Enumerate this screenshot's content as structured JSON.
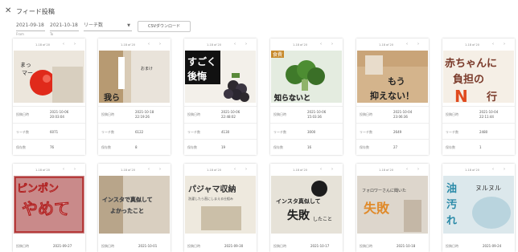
{
  "header": {
    "close_icon": "close-icon",
    "title": "フィード投稿",
    "date_from": "2021-09-18",
    "date_from_sub": "From",
    "date_to": "2021-10-18",
    "date_to_sub": "To",
    "sort_select": "リーチ数",
    "csv_button": "CSVダウンロード"
  },
  "labels": {
    "posted": "投稿日時",
    "reach": "リーチ数",
    "saves": "保存数"
  },
  "cards": [
    {
      "page": "1-18 of 20",
      "date": "2021-10-06",
      "time": "20:03:04",
      "reach": "6071",
      "saves": "76",
      "bg": "#e9e2d6"
    },
    {
      "page": "1-18 of 20",
      "date": "2021-10-18",
      "time": "22:19:26",
      "reach": "6122",
      "saves": "8",
      "bg": "#ddd2c3"
    },
    {
      "page": "1-18 of 20",
      "date": "2021-10-06",
      "time": "22:48:02",
      "reach": "4130",
      "saves": "19",
      "bg": "#f0ede8"
    },
    {
      "page": "1-18 of 20",
      "date": "2021-10-06",
      "time": "15:03:36",
      "reach": "3000",
      "saves": "16",
      "bg": "#d8e6d2"
    },
    {
      "page": "1-18 of 20",
      "date": "2021-10-04",
      "time": "23:06:36",
      "reach": "2649",
      "saves": "27",
      "bg": "#e6cfb0"
    },
    {
      "page": "1-18 of 20",
      "date": "2021-10-04",
      "time": "22:11:44",
      "reach": "2480",
      "saves": "1",
      "bg": "#f4ebe0"
    },
    {
      "page": "1-18 of 20",
      "date": "2021-09-27",
      "bg": "#c98a8a"
    },
    {
      "page": "1-18 of 20",
      "date": "2021-10-01",
      "bg": "#d9cfc0"
    },
    {
      "page": "1-18 of 20",
      "date": "2021-09-30",
      "bg": "#e8e2d5"
    },
    {
      "page": "1-18 of 20",
      "date": "2021-10-17",
      "bg": "#e6e2d8"
    },
    {
      "page": "1-18 of 20",
      "date": "2021-10-18",
      "bg": "#ddd6cc"
    },
    {
      "page": "1-18 of 20",
      "date": "2021-09-24",
      "bg": "#dce8ec"
    }
  ],
  "thumb_text": {
    "c0": "まっ\nマー",
    "c1a": "おまけ\n1回",
    "c1b": "我ら",
    "c2": "すごく\n後悔",
    "c3a": "食費",
    "c3b": "知らないと",
    "c4": "もう\n抑えない！",
    "c5a": "赤ちゃんに",
    "c5b": "負担の",
    "c5c": "N",
    "c5d": "行",
    "c6a": "ピンポン",
    "c6b": "やめて",
    "c7": "インスタで真似して\nよかったこと",
    "c8a": "パジャマ収納",
    "c8b": "洗濯したら直にしまえる仕組み",
    "c9a": "インスタ真似して",
    "c9b": "失敗",
    "c9c": "したこと",
    "c10a": "フォロワーさんに聞いた",
    "c10b": "失敗",
    "c11a": "油",
    "c11b": "汚",
    "c11c": "れ",
    "c11d": "ヌルヌル"
  }
}
